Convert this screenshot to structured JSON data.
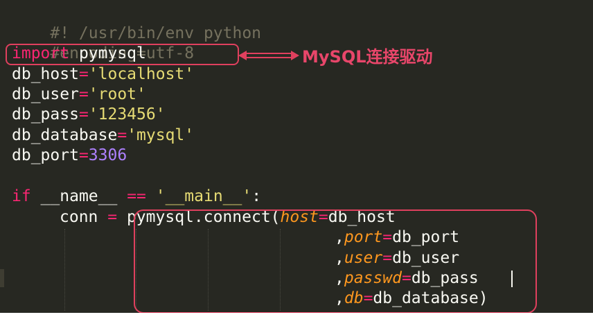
{
  "code": {
    "l1": "#! /usr/bin/env python",
    "l2": "#encoding=utf-8",
    "l3": {
      "kw": "import",
      "rest": " pymysql"
    },
    "l4": {
      "name": "db_host",
      "eq": "=",
      "val": "'localhost'"
    },
    "l5": {
      "name": "db_user",
      "eq": "=",
      "val": "'root'"
    },
    "l6": {
      "name": "db_pass",
      "eq": "=",
      "val": "'123456'"
    },
    "l7": {
      "name": "db_database",
      "eq": "=",
      "val": "'mysql'"
    },
    "l8": {
      "name": "db_port",
      "eq": "=",
      "val": "3306"
    },
    "l10": {
      "kw": "if",
      "a": " __name__ ",
      "op": "==",
      "b": " ",
      "str": "'__main__'",
      "c": ":"
    },
    "l11": {
      "a": "conn ",
      "op": "=",
      "b": " pymysql.connect(",
      "arg": "host",
      "eq": "=",
      "val": "db_host"
    },
    "l12": {
      "a": ",",
      "arg": "port",
      "eq": "=",
      "val": "db_port"
    },
    "l13": {
      "a": ",",
      "arg": "user",
      "eq": "=",
      "val": "db_user"
    },
    "l14": {
      "a": ",",
      "arg": "passwd",
      "eq": "=",
      "val": "db_pass"
    },
    "l15": {
      "a": ",",
      "arg": "db",
      "eq": "=",
      "val": "db_database",
      "close": ")"
    }
  },
  "annotation": {
    "label": "MySQL连接驱动",
    "color": "#e8466a"
  },
  "theme": {
    "background": "#272822",
    "keyword": "#f92672",
    "string": "#e6db74",
    "number": "#ae81ff",
    "comment": "#75715e",
    "argument": "#fd971f"
  }
}
